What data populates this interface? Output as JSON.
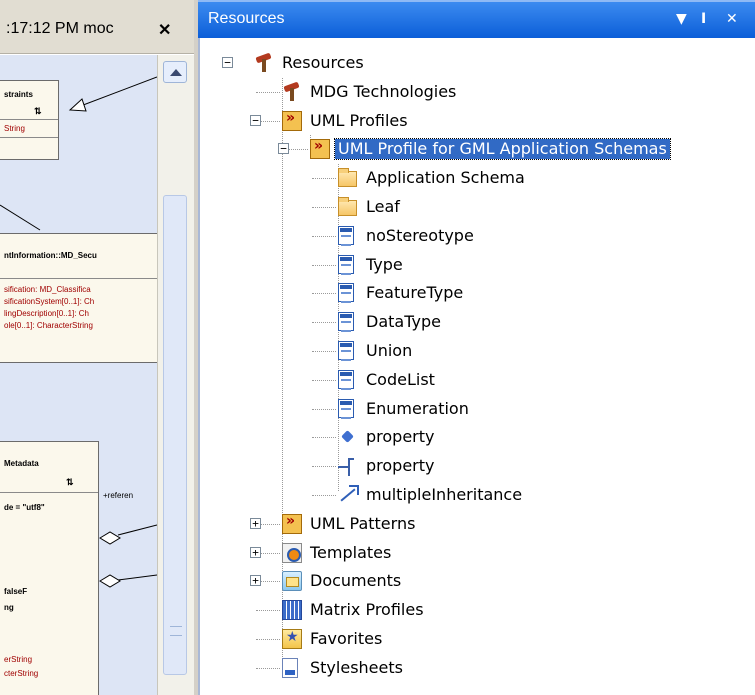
{
  "left_pane": {
    "tab_title": ":17:12 PM  moc",
    "close_glyph": "✕",
    "diagram": {
      "boxes": [
        {
          "name": "constraints-box",
          "header": "straints",
          "symbol": "⇅",
          "rows": [
            "String"
          ]
        },
        {
          "name": "security-box",
          "header": "ntInformation::MD_Secu",
          "rows": [
            "sification: MD_Classifica",
            "sificationSystem[0..1]: Ch",
            "lingDescription[0..1]: Ch",
            "ole[0..1]: CharacterString"
          ]
        },
        {
          "name": "metadata-box",
          "header": "Metadata",
          "symbol": "⇅",
          "rows": [
            "de = \"utf8\"",
            "",
            "",
            "falseF",
            "ng",
            "",
            "",
            "erString",
            "cterString"
          ]
        }
      ],
      "association_label": "+referen"
    }
  },
  "resources": {
    "title": "Resources",
    "header_buttons": [
      "▼",
      "Ⅰ",
      "✕"
    ],
    "tree": [
      {
        "id": "resources",
        "label": "Resources",
        "icon": "tools-icon",
        "expander": "−"
      },
      {
        "id": "mdg",
        "label": "MDG Technologies",
        "icon": "tools-icon"
      },
      {
        "id": "uml-profiles",
        "label": "UML Profiles",
        "icon": "profile-icon",
        "expander": "−"
      },
      {
        "id": "gml-profile",
        "label": "UML Profile for GML Application Schemas",
        "icon": "profile-icon",
        "expander": "−",
        "selected": true
      },
      {
        "id": "app-schema",
        "label": "Application Schema",
        "icon": "folder-icon"
      },
      {
        "id": "leaf",
        "label": "Leaf",
        "icon": "folder-icon"
      },
      {
        "id": "nostereotype",
        "label": "noStereotype",
        "icon": "class-icon"
      },
      {
        "id": "type",
        "label": "Type",
        "icon": "class-icon"
      },
      {
        "id": "featuretype",
        "label": "FeatureType",
        "icon": "class-icon"
      },
      {
        "id": "datatype",
        "label": "DataType",
        "icon": "class-icon"
      },
      {
        "id": "union",
        "label": "Union",
        "icon": "class-icon"
      },
      {
        "id": "codelist",
        "label": "CodeList",
        "icon": "class-icon"
      },
      {
        "id": "enumeration",
        "label": "Enumeration",
        "icon": "class-icon"
      },
      {
        "id": "property-1",
        "label": "property",
        "icon": "diamond-icon"
      },
      {
        "id": "property-2",
        "label": "property",
        "icon": "association-icon"
      },
      {
        "id": "multiple-inheritance",
        "label": "multipleInheritance",
        "icon": "generalization-icon"
      },
      {
        "id": "uml-patterns",
        "label": "UML Patterns",
        "icon": "profile-icon",
        "expander": "+"
      },
      {
        "id": "templates",
        "label": "Templates",
        "icon": "template-icon",
        "expander": "+"
      },
      {
        "id": "documents",
        "label": "Documents",
        "icon": "documents-icon",
        "expander": "+"
      },
      {
        "id": "matrix-profiles",
        "label": "Matrix Profiles",
        "icon": "matrix-icon"
      },
      {
        "id": "favorites",
        "label": "Favorites",
        "icon": "favorites-icon"
      },
      {
        "id": "stylesheets",
        "label": "Stylesheets",
        "icon": "stylesheet-icon"
      }
    ]
  }
}
